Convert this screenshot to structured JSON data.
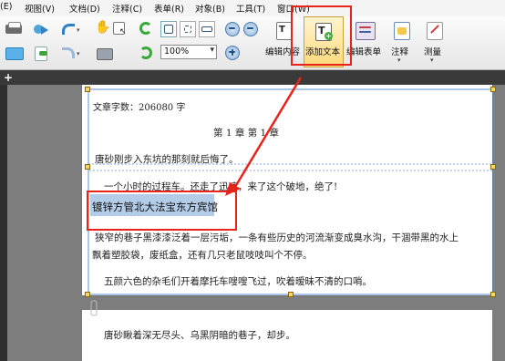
{
  "menu": {
    "items": [
      "(E)",
      "视图(V)",
      "文档(D)",
      "注释(C)",
      "表单(R)",
      "对象(B)",
      "工具(T)",
      "窗口(W)"
    ]
  },
  "toolbar": {
    "zoom_value": "100%",
    "edit_content_label": "编辑内容",
    "add_text_label": "添加文本",
    "edit_form_label": "编辑表单",
    "annotate_label": "注释",
    "measure_label": "测量"
  },
  "document": {
    "word_count": "文章字数：206080 字",
    "chapter": "第 1 章  第 1 章",
    "line1": "唐砂刚步入东坑的那刻就后悔了。",
    "line2": "一个小时的过程车。还走了迅速，来了这个破地，绝了!",
    "added_text": "镀锌方管北大法宝东方宾馆",
    "para1_a": "狭窄的巷子黑漆漆泛着一层污垢，一条有些历史的河流渐变成臭水沟，干涸带黑的水上",
    "para1_b": "飘着塑胶袋，废纸盒，还有几只老鼠吱吱叫个不停。",
    "para2": "五颜六色的杂毛们开着摩托车嗖嗖飞过，吹着暧昧不清的口哨。",
    "page2_line": "唐砂瞅着深无尽头、乌黑阴暗的巷子，却步。"
  },
  "colors": {
    "highlight_box": "#e8231a",
    "selection": "#b3cce8",
    "frame": "#5a8fd6"
  }
}
